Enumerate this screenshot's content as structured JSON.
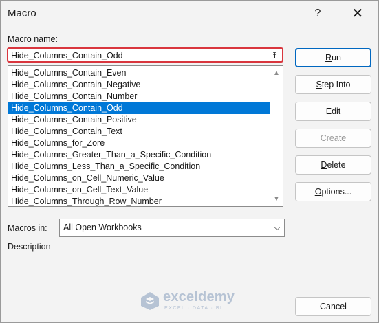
{
  "window": {
    "title": "Macro",
    "help_glyph": "?",
    "close_glyph": "✕"
  },
  "macro_name": {
    "label_key": "M",
    "label_rest": "acro name:",
    "value": "Hide_Columns_Contain_Odd",
    "arrow_glyph": "⭱"
  },
  "macro_list": {
    "items": [
      "Hide_Columns_Contain_Even",
      "Hide_Columns_Contain_Negative",
      "Hide_Columns_Contain_Number",
      "Hide_Columns_Contain_Odd",
      "Hide_Columns_Contain_Positive",
      "Hide_Columns_Contain_Text",
      "Hide_Columns_for_Zore",
      "Hide_Columns_Greater_Than_a_Specific_Condition",
      "Hide_Columns_Less_Than_a_Specific_Condition",
      "Hide_Columns_on_Cell_Numeric_Value",
      "Hide_Columns_on_Cell_Text_Value",
      "Hide_Columns_Through_Row_Number"
    ],
    "selected_index": 3,
    "scroll_up_glyph": "▲",
    "scroll_down_glyph": "▼"
  },
  "buttons": {
    "run": {
      "key": "R",
      "rest": "un"
    },
    "step_into": {
      "key": "S",
      "rest": "tep Into"
    },
    "edit": {
      "key": "E",
      "rest": "dit"
    },
    "create": {
      "label": "Create"
    },
    "delete": {
      "key": "D",
      "rest": "elete"
    },
    "options": {
      "key": "O",
      "rest": "ptions..."
    },
    "cancel": {
      "label": "Cancel"
    }
  },
  "macros_in": {
    "label_prefix": "Macros ",
    "label_key": "i",
    "label_rest": "n:",
    "value": "All Open Workbooks",
    "arrow_glyph": "⌵"
  },
  "description": {
    "label": "Description"
  },
  "watermark": {
    "name": "exceldemy",
    "tagline": "EXCEL · DATA · BI"
  },
  "colors": {
    "selection": "#0078d7",
    "focus_border": "#d9363e",
    "default_button_border": "#0067c0"
  }
}
